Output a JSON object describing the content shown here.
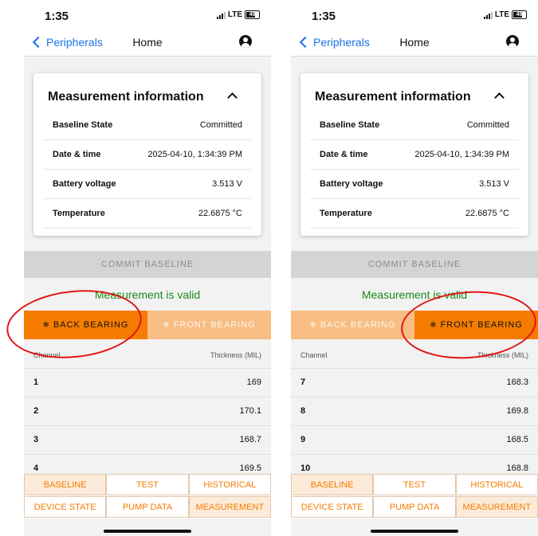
{
  "colors": {
    "accent": "#f57c00",
    "accent_light": "#f7bd83",
    "link": "#1a73e8",
    "valid": "#188b1c",
    "annotation": "#e11414"
  },
  "screens": [
    {
      "status": {
        "time": "1:35",
        "network": "LTE",
        "battery": "49"
      },
      "nav": {
        "back_label": "Peripherals",
        "title": "Home",
        "icons": [
          "chevron-left-icon",
          "user-icon"
        ]
      },
      "card": {
        "title": "Measurement information",
        "rows": [
          {
            "label": "Baseline State",
            "value": "Committed"
          },
          {
            "label": "Date & time",
            "value": "2025-04-10, 1:34:39 PM"
          },
          {
            "label": "Battery voltage",
            "value": "3.513 V"
          },
          {
            "label": "Temperature",
            "value": "22.6875 °C"
          }
        ]
      },
      "commit_label": "COMMIT BASELINE",
      "status_message": "Measurement is valid",
      "tabs": [
        {
          "label": "BACK BEARING",
          "active": true
        },
        {
          "label": "FRONT BEARING",
          "active": false
        }
      ],
      "table": {
        "headers": [
          "Channel",
          "Thickness (MIL)"
        ],
        "rows": [
          [
            "1",
            "169"
          ],
          [
            "2",
            "170.1"
          ],
          [
            "3",
            "168.7"
          ],
          [
            "4",
            "169.5"
          ]
        ]
      },
      "bottom_nav": [
        {
          "label": "BASELINE",
          "active": true
        },
        {
          "label": "TEST",
          "active": false
        },
        {
          "label": "HISTORICAL",
          "active": false
        },
        {
          "label": "DEVICE STATE",
          "active": false
        },
        {
          "label": "PUMP DATA",
          "active": false
        },
        {
          "label": "MEASUREMENT",
          "active": true
        }
      ]
    },
    {
      "status": {
        "time": "1:35",
        "network": "LTE",
        "battery": "49"
      },
      "nav": {
        "back_label": "Peripherals",
        "title": "Home",
        "icons": [
          "chevron-left-icon",
          "user-icon"
        ]
      },
      "card": {
        "title": "Measurement information",
        "rows": [
          {
            "label": "Baseline State",
            "value": "Committed"
          },
          {
            "label": "Date & time",
            "value": "2025-04-10, 1:34:39 PM"
          },
          {
            "label": "Battery voltage",
            "value": "3.513 V"
          },
          {
            "label": "Temperature",
            "value": "22.6875 °C"
          }
        ]
      },
      "commit_label": "COMMIT BASELINE",
      "status_message": "Measurement is valid",
      "tabs": [
        {
          "label": "BACK BEARING",
          "active": false
        },
        {
          "label": "FRONT BEARING",
          "active": true
        }
      ],
      "table": {
        "headers": [
          "Channel",
          "Thickness (MIL)"
        ],
        "rows": [
          [
            "7",
            "168.3"
          ],
          [
            "8",
            "169.8"
          ],
          [
            "9",
            "168.5"
          ],
          [
            "10",
            "168.8"
          ]
        ]
      },
      "bottom_nav": [
        {
          "label": "BASELINE",
          "active": true
        },
        {
          "label": "TEST",
          "active": false
        },
        {
          "label": "HISTORICAL",
          "active": false
        },
        {
          "label": "DEVICE STATE",
          "active": false
        },
        {
          "label": "PUMP DATA",
          "active": false
        },
        {
          "label": "MEASUREMENT",
          "active": true
        }
      ]
    }
  ]
}
